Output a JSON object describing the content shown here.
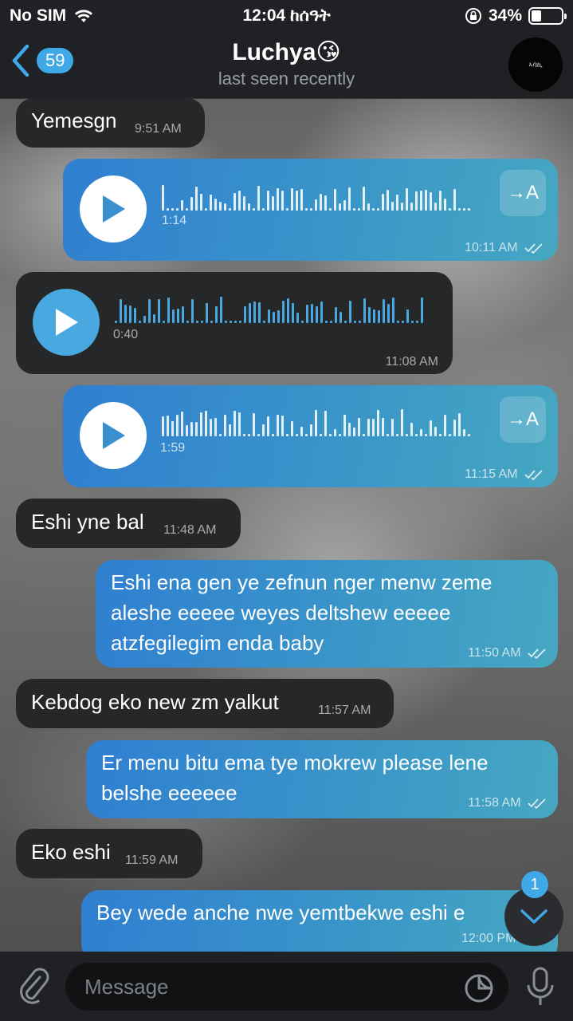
{
  "status_bar": {
    "carrier": "No SIM",
    "time": "12:04 ከሰዓት",
    "battery": "34%",
    "battery_level": 0.34
  },
  "header": {
    "back_badge": "59",
    "title": "Luchya😘",
    "subtitle": "last seen recently",
    "avatar_text": "ኣባኪ"
  },
  "messages": [
    {
      "dir": "in",
      "type": "text",
      "text": "Yemesgn",
      "time": "9:51 AM"
    },
    {
      "dir": "out",
      "type": "voice",
      "duration": "1:14",
      "time": "10:11 AM",
      "transcribe": "→A"
    },
    {
      "dir": "in",
      "type": "voice",
      "duration": "0:40",
      "time": "11:08 AM"
    },
    {
      "dir": "out",
      "type": "voice",
      "duration": "1:59",
      "time": "11:15 AM",
      "transcribe": "→A"
    },
    {
      "dir": "in",
      "type": "text",
      "text": "Eshi yne bal",
      "time": "11:48 AM"
    },
    {
      "dir": "out",
      "type": "text",
      "lines": [
        "Eshi ena gen ye zefnun nger menw zeme",
        "aleshe eeeee weyes deltshew eeeee",
        "atzfegilegim enda baby"
      ],
      "time": "11:50 AM"
    },
    {
      "dir": "in",
      "type": "text",
      "text": "Kebdog eko new zm yalkut",
      "time": "11:57 AM"
    },
    {
      "dir": "out",
      "type": "text",
      "lines": [
        "Er menu bitu ema tye mokrew please lene",
        "belshe eeeeee"
      ],
      "time": "11:58 AM"
    },
    {
      "dir": "in",
      "type": "text",
      "text": "Eko eshi",
      "time": "11:59 AM"
    },
    {
      "dir": "out",
      "type": "text",
      "text": "Bey wede anche nwe yemtbekwe eshi e",
      "time": "12:00 PM"
    }
  ],
  "scroll_badge": "1",
  "input": {
    "placeholder": "Message"
  },
  "colors": {
    "accent": "#3fa8e6",
    "incoming": "#262729",
    "outgoing_start": "#2f7fd1",
    "outgoing_end": "#46a7c2"
  }
}
